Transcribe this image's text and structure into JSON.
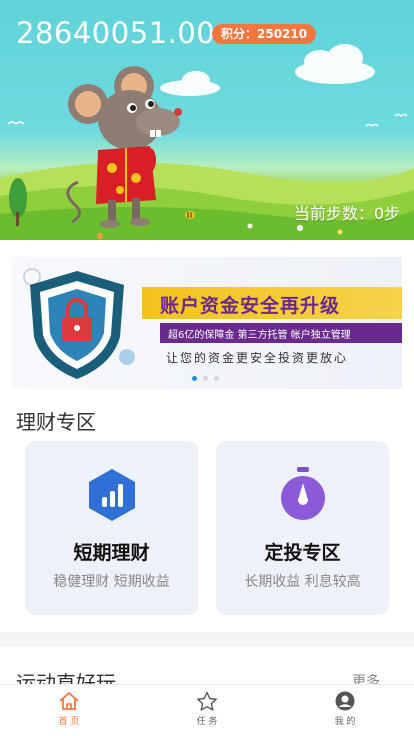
{
  "hero": {
    "balance": "28640051.00",
    "points_label": "积分：250210",
    "steps_label": "当前步数：0步"
  },
  "banner": {
    "headline": "账户资金安全再升级",
    "subline": "超6亿的保障金  第三方托管  帐户独立管理",
    "tagline": "让您的资金更安全投资更放心",
    "slide_count": 3,
    "active_slide": 1
  },
  "finance": {
    "title": "理财专区",
    "cards": [
      {
        "title": "短期理财",
        "desc": "稳健理财 短期收益",
        "icon": "bar-chart-hexagon-icon"
      },
      {
        "title": "定投专区",
        "desc": "长期收益 利息较高",
        "icon": "stopwatch-icon"
      }
    ]
  },
  "sports": {
    "title": "运动直好玩",
    "more": "更多"
  },
  "tabbar": {
    "items": [
      {
        "label": "首 页",
        "icon": "home-icon",
        "active": true
      },
      {
        "label": "任 务",
        "icon": "star-icon",
        "active": false
      },
      {
        "label": "我 的",
        "icon": "profile-icon",
        "active": false
      }
    ]
  },
  "colors": {
    "accent": "#f4763f",
    "card_bg": "#eef1f7",
    "banner_purple": "#6a2a8d",
    "banner_yellow": "#f4c21c"
  }
}
